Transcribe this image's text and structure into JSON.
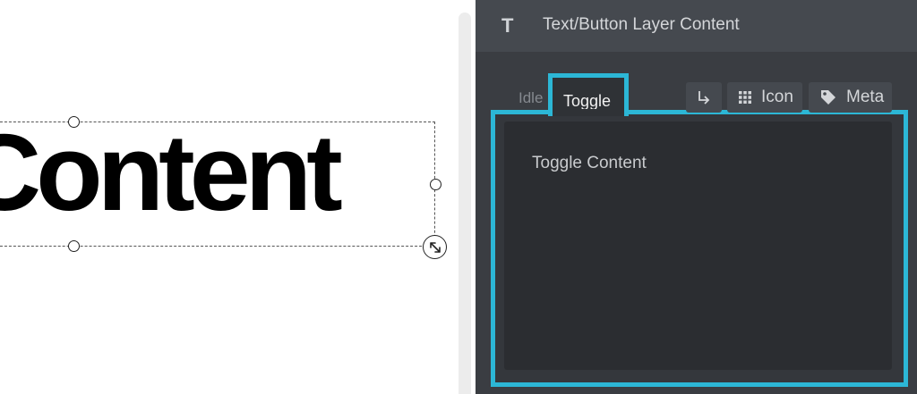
{
  "canvas": {
    "layer_text": "Content"
  },
  "panel": {
    "header_icon": "text-type-icon",
    "header_title": "Text/Button Layer Content",
    "tabs": {
      "idle": "Idle",
      "toggle": "Toggle"
    },
    "buttons": {
      "link_icon": "return-arrow-icon",
      "icon_label": "Icon",
      "meta_label": "Meta"
    },
    "editor_text": "Toggle Content",
    "accent_color": "#2cb7d6"
  }
}
